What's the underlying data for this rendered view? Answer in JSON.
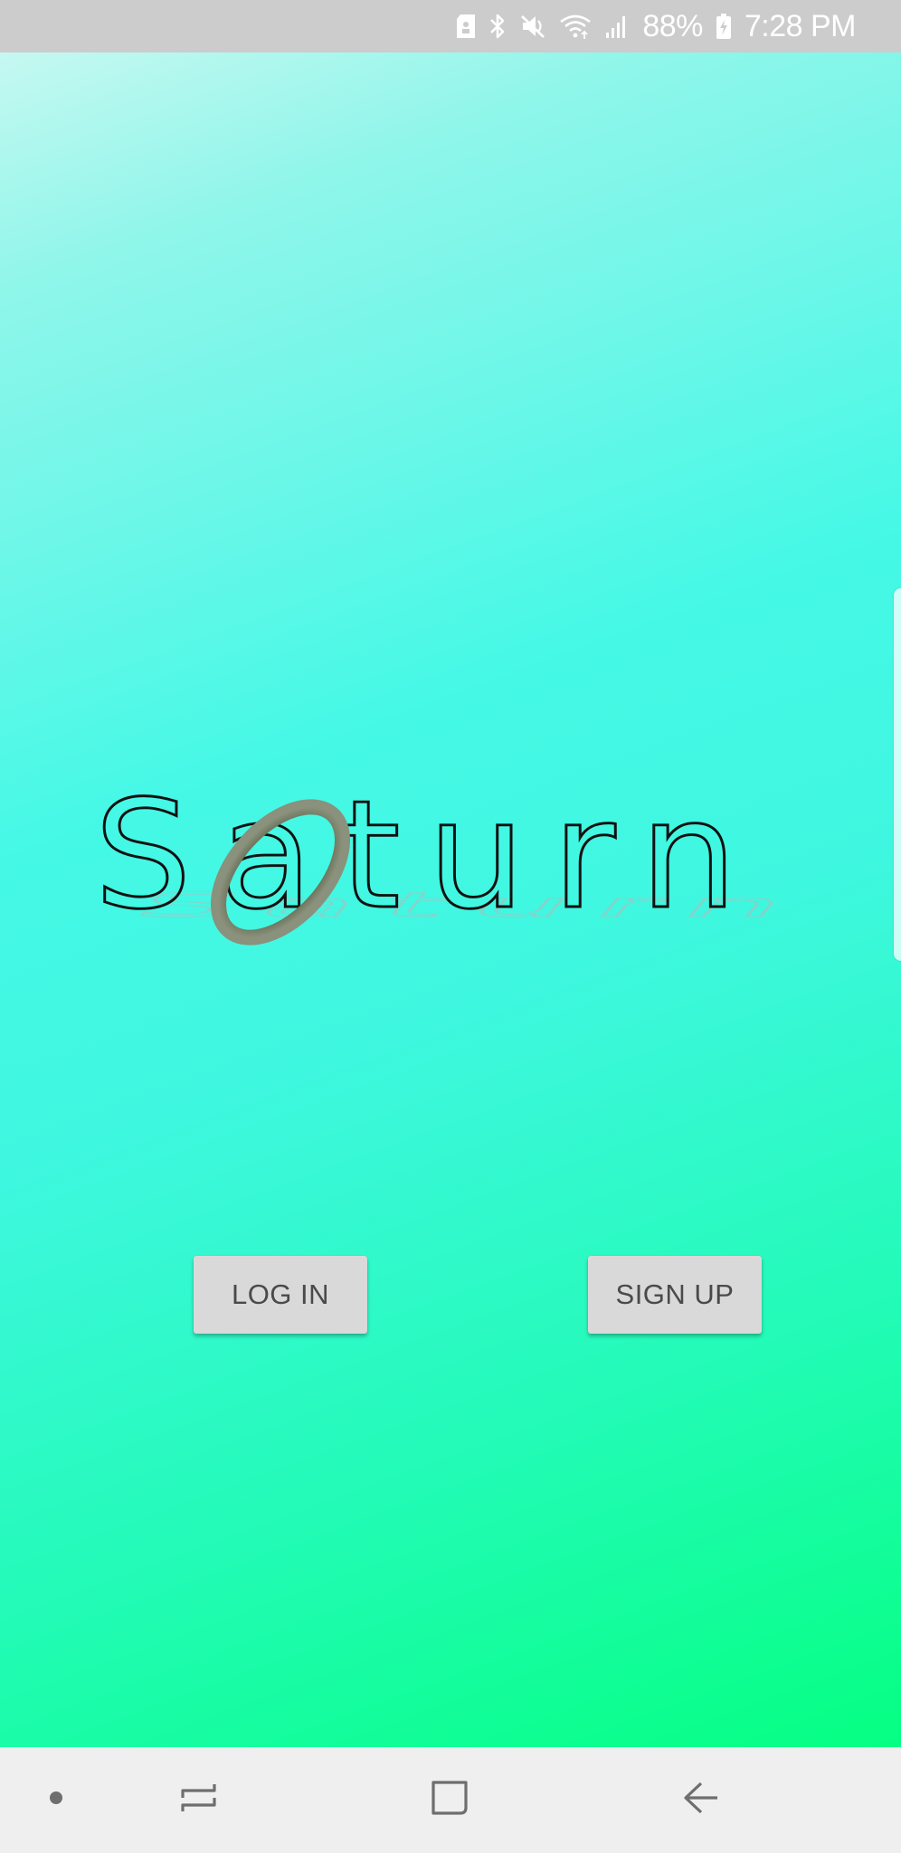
{
  "status_bar": {
    "battery_percent": "88%",
    "time": "7:28 PM",
    "icons": [
      "sd-card-icon",
      "bluetooth-icon",
      "mute-icon",
      "wifi-icon",
      "signal-icon",
      "battery-charging-icon"
    ]
  },
  "app": {
    "logo_text": "Saturn",
    "login_label": "LOG IN",
    "signup_label": "SIGN UP",
    "colors": {
      "gradient_top": "#c5f8f1",
      "gradient_mid": "#45f8e6",
      "gradient_bottom": "#05ff82",
      "ring": "#6f7a60",
      "button_bg": "#d9d9d9",
      "button_text": "#4a4a4a"
    }
  },
  "nav_bar": {
    "items": [
      "dot-icon",
      "recents-icon",
      "home-icon",
      "back-icon"
    ]
  }
}
